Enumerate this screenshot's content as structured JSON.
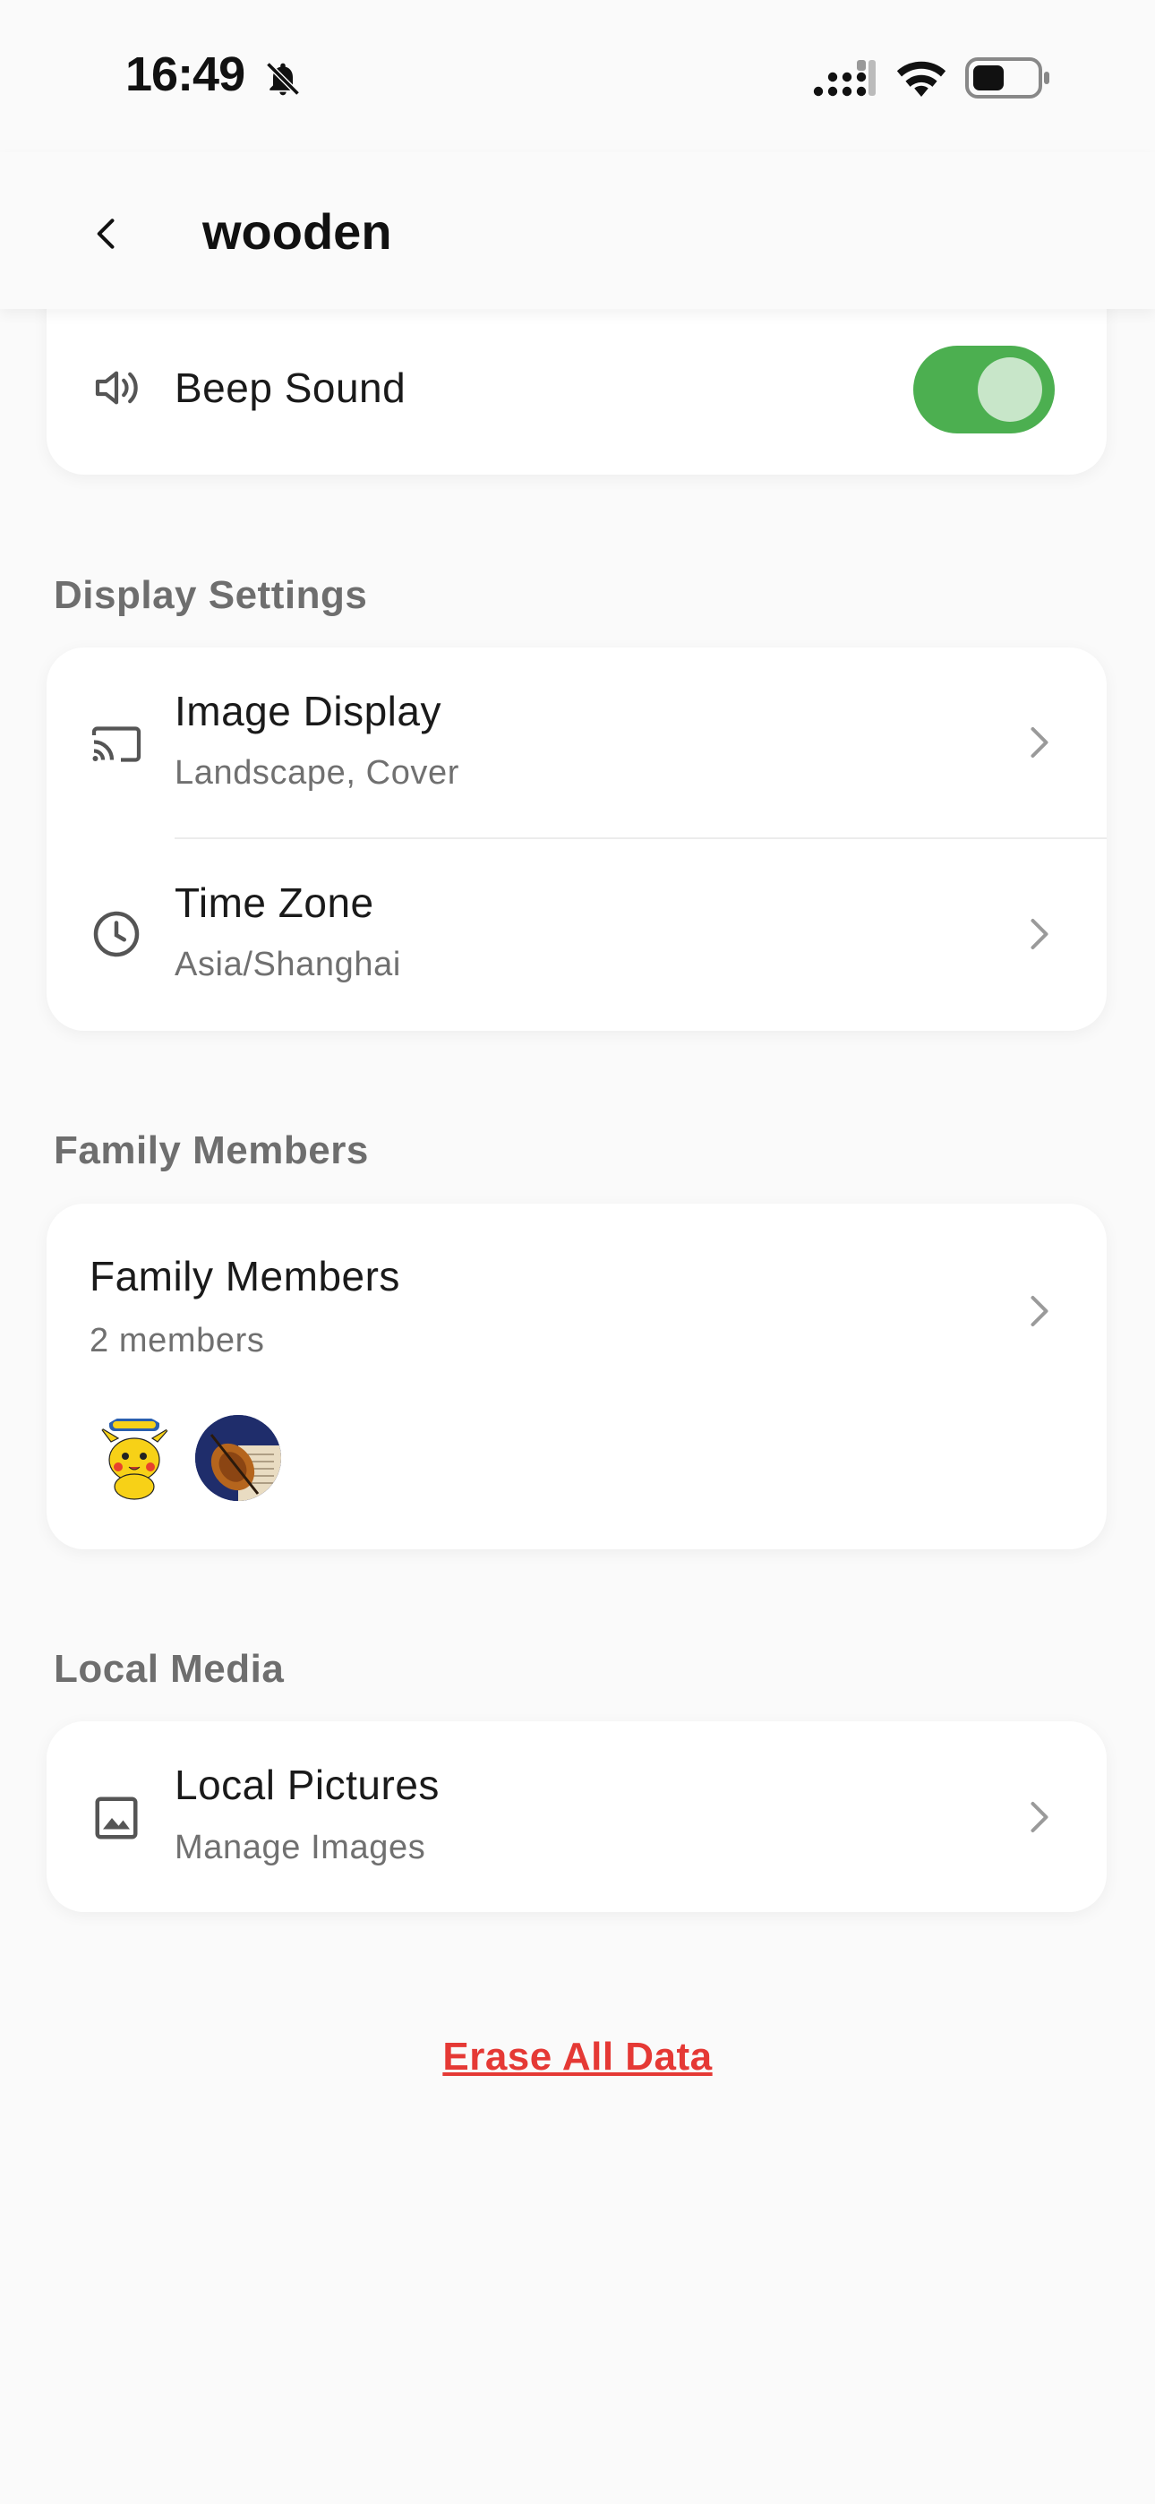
{
  "status_bar": {
    "time": "16:49",
    "icons": [
      "bell-slash-icon",
      "signal-icon",
      "wifi-icon",
      "battery-icon"
    ]
  },
  "header": {
    "back_icon": "chevron-left-icon",
    "title": "wooden"
  },
  "beep": {
    "icon": "speaker-icon",
    "label": "Beep Sound",
    "toggle_on": true
  },
  "display_settings": {
    "section_title": "Display Settings",
    "items": [
      {
        "icon": "cast-icon",
        "title": "Image Display",
        "subtitle": "Landscape, Cover"
      },
      {
        "icon": "clock-icon",
        "title": "Time Zone",
        "subtitle": "Asia/Shanghai"
      }
    ]
  },
  "family": {
    "section_title": "Family Members",
    "title": "Family Members",
    "subtitle": "2 members",
    "avatars": [
      "pikachu-avatar",
      "violin-avatar"
    ]
  },
  "local_media": {
    "section_title": "Local Media",
    "items": [
      {
        "icon": "image-icon",
        "title": "Local Pictures",
        "subtitle": "Manage Images"
      }
    ]
  },
  "erase": {
    "label": "Erase All Data"
  },
  "colors": {
    "accent_green": "#4caf50",
    "danger_red": "#e53935",
    "background": "#fafafa"
  }
}
